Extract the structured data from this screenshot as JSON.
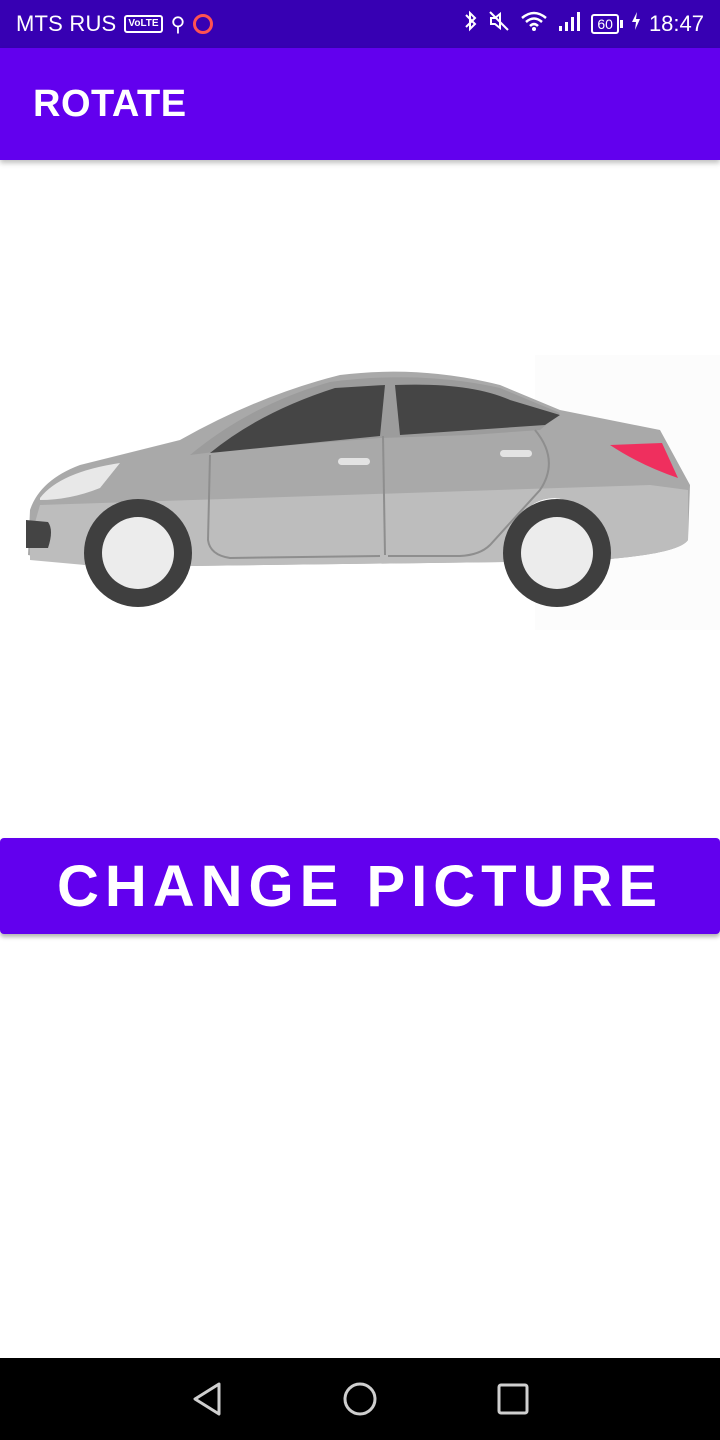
{
  "status_bar": {
    "carrier": "MTS RUS",
    "volte": "VoLTE",
    "usb_icon": "usb-icon",
    "battery": "60",
    "time": "18:47"
  },
  "app_bar": {
    "title": "ROTATE"
  },
  "main": {
    "image": "car-side-view",
    "button_label": "CHANGE PICTURE"
  },
  "nav_bar": {
    "back": "back-icon",
    "home": "home-icon",
    "recents": "recents-icon"
  },
  "colors": {
    "status_bar": "#3700b3",
    "primary": "#6200ee",
    "background": "#ffffff",
    "nav_bar": "#000000"
  }
}
